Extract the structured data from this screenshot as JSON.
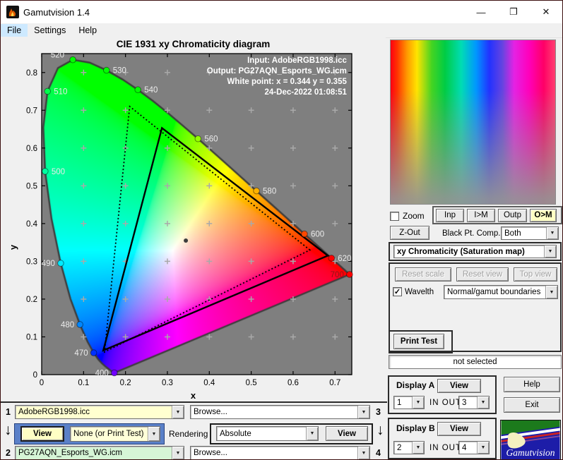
{
  "window": {
    "title": "Gamutvision 1.4"
  },
  "titlebar": {
    "minimize_glyph": "—",
    "maximize_glyph": "❐",
    "close_glyph": "✕"
  },
  "menubar": {
    "items": [
      {
        "label": "File"
      },
      {
        "label": "Settings"
      },
      {
        "label": "Help"
      }
    ]
  },
  "chart_data": {
    "type": "chromaticity-diagram",
    "title": "CIE 1931 xy Chromaticity diagram",
    "xlabel": "x",
    "ylabel": "y",
    "xlim": [
      0,
      0.74
    ],
    "ylim": [
      0,
      0.85
    ],
    "xticks": [
      0,
      0.1,
      0.2,
      0.3,
      0.4,
      0.5,
      0.6,
      0.7
    ],
    "yticks": [
      0,
      0.1,
      0.2,
      0.3,
      0.4,
      0.5,
      0.6,
      0.7,
      0.8
    ],
    "grid_step": 0.1,
    "grid_color": "#a9a9a9",
    "plot_bg": "#7f7f7f",
    "annotations": [
      "Input:  AdobeRGB1998.icc",
      "Output: PG27AQN_Esports_WG.icm",
      "White point:  x = 0.344  y = 0.355",
      "24-Dec-2022 01:08:51"
    ],
    "white_point": {
      "x": 0.344,
      "y": 0.355
    },
    "gamuts": [
      {
        "name": "Output PG27AQN_Esports_WG",
        "style": "solid",
        "points": [
          [
            0.683,
            0.315
          ],
          [
            0.287,
            0.653
          ],
          [
            0.147,
            0.064
          ]
        ]
      },
      {
        "name": "Input AdobeRGB1998",
        "style": "dotted",
        "points": [
          [
            0.64,
            0.33
          ],
          [
            0.21,
            0.71
          ],
          [
            0.15,
            0.06
          ]
        ]
      }
    ],
    "wavelength_markers": [
      {
        "wl": "400",
        "x": 0.1733,
        "y": 0.0048,
        "side": "left"
      },
      {
        "wl": "470",
        "x": 0.1241,
        "y": 0.0578,
        "side": "left"
      },
      {
        "wl": "480",
        "x": 0.0913,
        "y": 0.1327,
        "side": "left"
      },
      {
        "wl": "490",
        "x": 0.0454,
        "y": 0.295,
        "side": "left"
      },
      {
        "wl": "500",
        "x": 0.0082,
        "y": 0.5384,
        "side": "right"
      },
      {
        "wl": "510",
        "x": 0.0139,
        "y": 0.7502,
        "side": "right"
      },
      {
        "wl": "520",
        "x": 0.0743,
        "y": 0.8338,
        "side": "left",
        "dx": -4,
        "dy": -7
      },
      {
        "wl": "530",
        "x": 0.1547,
        "y": 0.8059,
        "side": "right"
      },
      {
        "wl": "540",
        "x": 0.2296,
        "y": 0.7543,
        "side": "right"
      },
      {
        "wl": "560",
        "x": 0.3731,
        "y": 0.6245,
        "side": "right"
      },
      {
        "wl": "580",
        "x": 0.5125,
        "y": 0.4866,
        "side": "right"
      },
      {
        "wl": "600",
        "x": 0.627,
        "y": 0.3725,
        "side": "right"
      },
      {
        "wl": "620",
        "x": 0.6915,
        "y": 0.3083,
        "side": "right"
      },
      {
        "wl": "700",
        "x": 0.7347,
        "y": 0.2653,
        "side": "left",
        "label_color": "#8b1616"
      }
    ],
    "locus": [
      [
        0.1741,
        0.005
      ],
      [
        0.174,
        0.005
      ],
      [
        0.1738,
        0.0049
      ],
      [
        0.1736,
        0.0049
      ],
      [
        0.1733,
        0.0048
      ],
      [
        0.173,
        0.0048
      ],
      [
        0.1726,
        0.0048
      ],
      [
        0.1721,
        0.0048
      ],
      [
        0.1714,
        0.0051
      ],
      [
        0.1703,
        0.0058
      ],
      [
        0.1689,
        0.0069
      ],
      [
        0.1669,
        0.0086
      ],
      [
        0.1644,
        0.0109
      ],
      [
        0.1611,
        0.0138
      ],
      [
        0.1566,
        0.0177
      ],
      [
        0.151,
        0.0227
      ],
      [
        0.144,
        0.0297
      ],
      [
        0.1355,
        0.0399
      ],
      [
        0.1241,
        0.0578
      ],
      [
        0.1096,
        0.0868
      ],
      [
        0.0913,
        0.1327
      ],
      [
        0.0687,
        0.2007
      ],
      [
        0.0454,
        0.295
      ],
      [
        0.0235,
        0.4127
      ],
      [
        0.0082,
        0.5384
      ],
      [
        0.0039,
        0.6548
      ],
      [
        0.0139,
        0.7502
      ],
      [
        0.0389,
        0.812
      ],
      [
        0.0743,
        0.8338
      ],
      [
        0.1142,
        0.8262
      ],
      [
        0.1547,
        0.8059
      ],
      [
        0.1929,
        0.7816
      ],
      [
        0.2296,
        0.7543
      ],
      [
        0.2658,
        0.7243
      ],
      [
        0.3016,
        0.6923
      ],
      [
        0.3373,
        0.6589
      ],
      [
        0.3731,
        0.6245
      ],
      [
        0.4087,
        0.5896
      ],
      [
        0.4441,
        0.5547
      ],
      [
        0.4788,
        0.5202
      ],
      [
        0.5125,
        0.4866
      ],
      [
        0.5448,
        0.4544
      ],
      [
        0.5752,
        0.4242
      ],
      [
        0.6029,
        0.3965
      ],
      [
        0.627,
        0.3725
      ],
      [
        0.6482,
        0.3514
      ],
      [
        0.6658,
        0.334
      ],
      [
        0.6801,
        0.3197
      ],
      [
        0.6915,
        0.3083
      ],
      [
        0.7006,
        0.2993
      ],
      [
        0.7079,
        0.292
      ],
      [
        0.714,
        0.2859
      ],
      [
        0.719,
        0.2809
      ],
      [
        0.723,
        0.277
      ],
      [
        0.726,
        0.274
      ],
      [
        0.7283,
        0.2717
      ],
      [
        0.73,
        0.27
      ],
      [
        0.732,
        0.268
      ],
      [
        0.7334,
        0.2666
      ],
      [
        0.7347,
        0.2653
      ]
    ]
  },
  "right_panel": {
    "zoom_checkbox_label": "Zoom",
    "view_buttons": [
      {
        "label": "Inp"
      },
      {
        "label": "I>M"
      },
      {
        "label": "Outp"
      },
      {
        "label": "O>M"
      }
    ],
    "zout_button": "Z-Out",
    "black_pt_label": "Black Pt. Comp.",
    "black_pt_value": "Both",
    "mode_select": "xy Chromaticity (Saturation map)",
    "reset_scale": "Reset scale",
    "reset_view": "Reset view",
    "top_view": "Top view",
    "wavelth_label": "Wavelth",
    "wavelth_checked": "✓",
    "wavelth_select": "Normal/gamut boundaries",
    "print_test": "Print Test",
    "status": "not selected",
    "display_a": {
      "title": "Display A",
      "view": "View",
      "in": "1",
      "inout_label": "IN  OUT",
      "out": "3"
    },
    "display_b": {
      "title": "Display B",
      "view": "View",
      "in": "2",
      "inout_label": "IN  OUT",
      "out": "4"
    },
    "help": "Help",
    "exit": "Exit",
    "logo_text": "Gamutvision"
  },
  "bottom_panel": {
    "row1_num": "1",
    "row2_num": "2",
    "row3_num": "3",
    "row4_num": "4",
    "arrow_glyph": "↓",
    "profile1": "AdobeRGB1998.icc",
    "profile2": "PG27AQN_Esports_WG.icm",
    "browse1": "Browse...",
    "browse2": "Browse...",
    "view_left": "View",
    "view_right": "View",
    "pattern_select": "None (or Print Test)",
    "rendering_label": "Rendering",
    "rendering_select": "Absolute"
  }
}
